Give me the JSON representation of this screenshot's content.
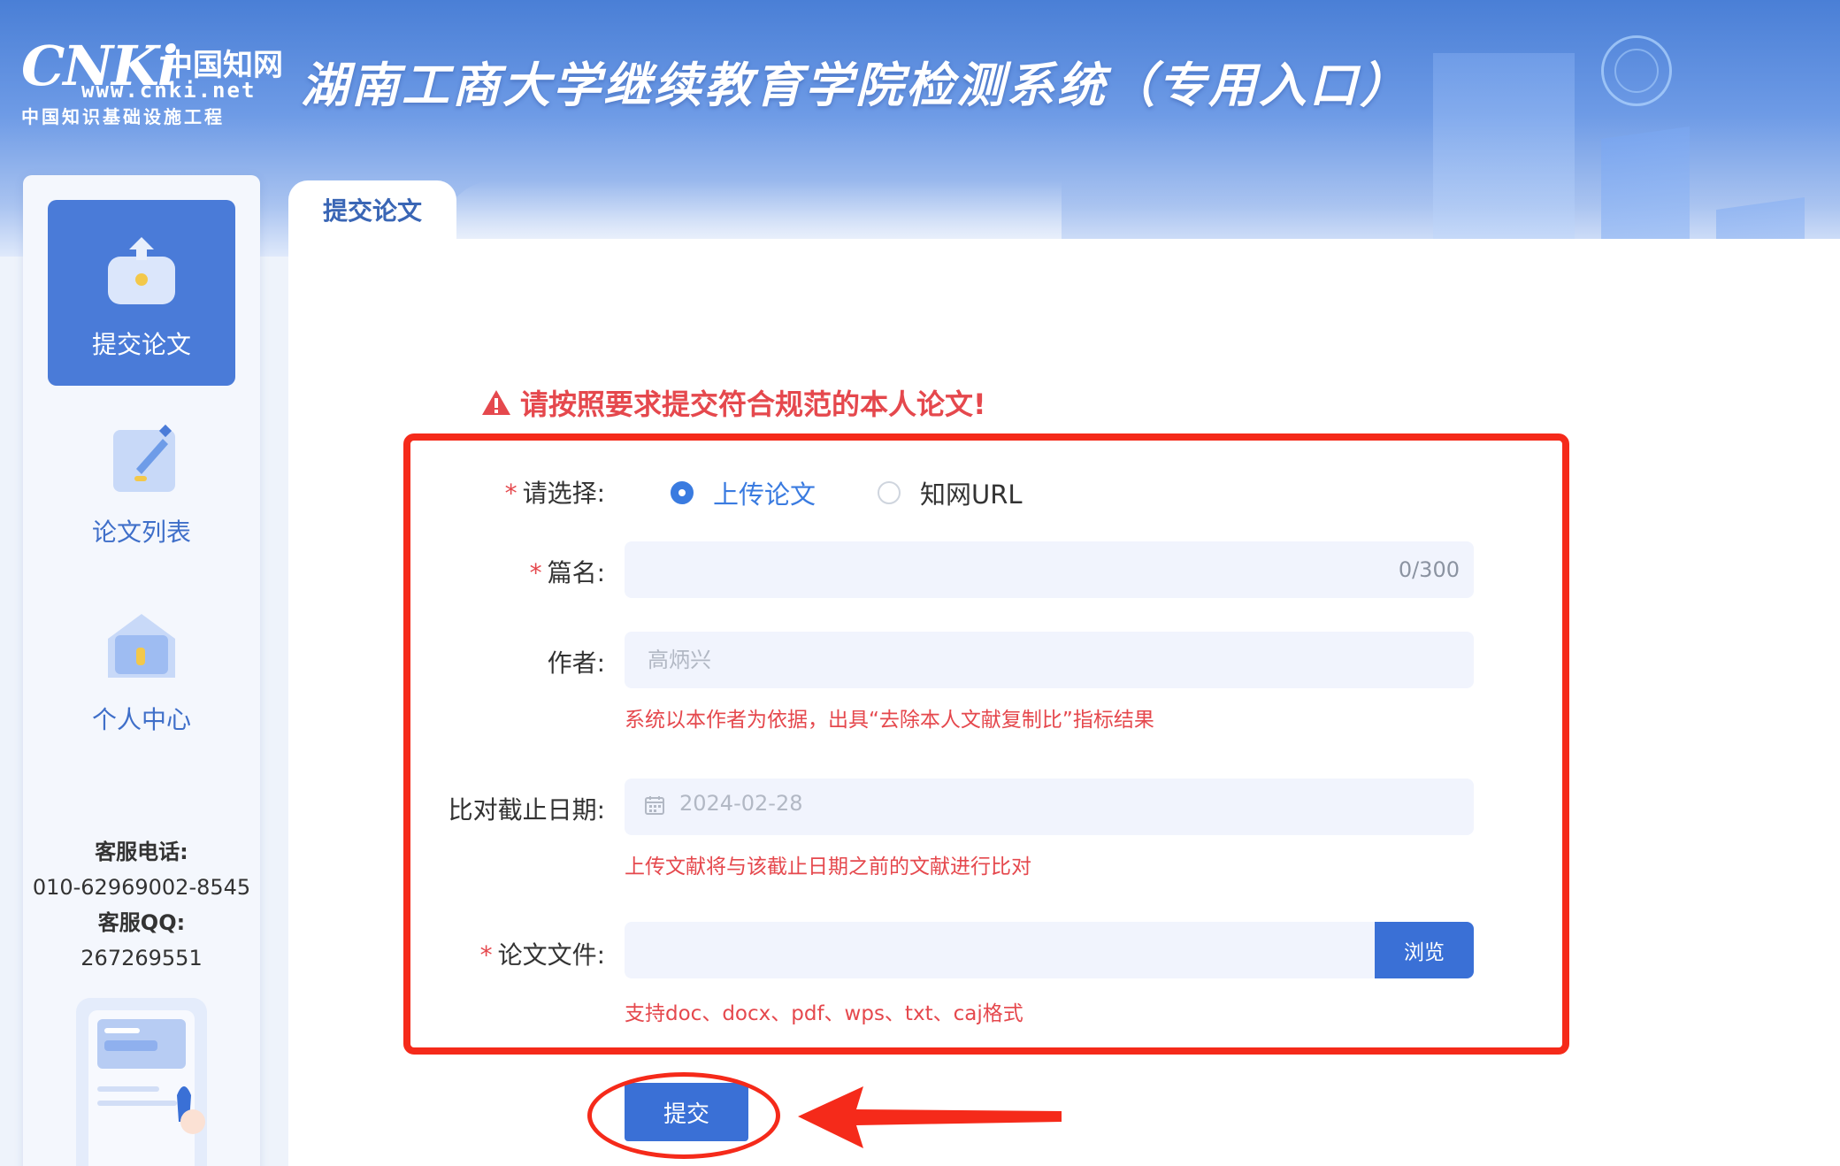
{
  "header": {
    "logo_mark": "CNKi",
    "logo_cn": "中国知网",
    "logo_url": "www.cnki.net",
    "logo_sub": "中国知识基础设施工程",
    "title": "湖南工商大学继续教育学院检测系统（专用入口）"
  },
  "sidebar": {
    "items": [
      {
        "label": "提交论文",
        "icon": "upload-box-icon",
        "active": true
      },
      {
        "label": "论文列表",
        "icon": "edit-document-icon",
        "active": false
      },
      {
        "label": "个人中心",
        "icon": "home-icon",
        "active": false
      }
    ],
    "contact": {
      "phone_label": "客服电话:",
      "phone": "010-62969002-8545",
      "qq_label": "客服QQ:",
      "qq": "267269551"
    }
  },
  "tab": {
    "label": "提交论文"
  },
  "form": {
    "warning": "请按照要求提交符合规范的本人论文!",
    "choose_label": "请选择:",
    "options": [
      {
        "label": "上传论文",
        "checked": true
      },
      {
        "label": "知网URL",
        "checked": false
      }
    ],
    "title_label": "篇名:",
    "title_value": "",
    "title_counter": "0/300",
    "author_label": "作者:",
    "author_placeholder": "高炳兴",
    "author_hint": "系统以本作者为依据，出具“去除本人文献复制比”指标结果",
    "date_label": "比对截止日期:",
    "date_value": "2024-02-28",
    "date_hint": "上传文献将与该截止日期之前的文献进行比对",
    "file_label": "论文文件:",
    "file_value": "",
    "browse_label": "浏览",
    "file_hint": "支持doc、docx、pdf、wps、txt、caj格式",
    "submit_label": "提交"
  },
  "colors": {
    "accent": "#3a70d6",
    "warning": "#e5484d",
    "highlight_border": "#f52a1a"
  }
}
